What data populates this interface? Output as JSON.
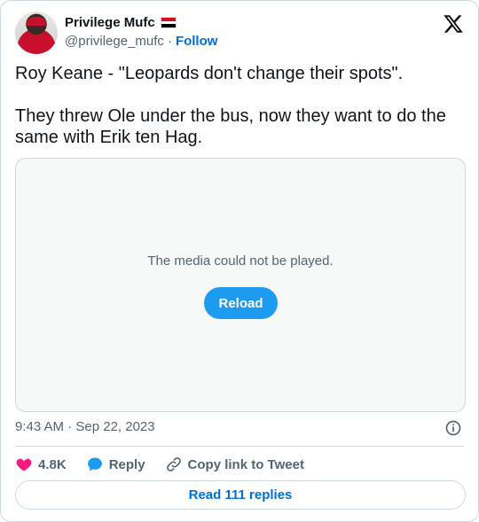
{
  "author": {
    "name": "Privilege Mufc",
    "handle": "@privilege_mufc",
    "separator": "·",
    "follow_label": "Follow",
    "flag_colors": [
      "#ce1126",
      "#ffffff",
      "#000000"
    ]
  },
  "tweet": {
    "text": "Roy Keane - \"Leopards don't change their spots\".\n\nThey threw Ole under the bus, now they want to do the same with Erik ten Hag.",
    "timestamp": "9:43 AM · Sep 22, 2023"
  },
  "media": {
    "message": "The media could not be played.",
    "reload_label": "Reload"
  },
  "actions": {
    "likes": "4.8K",
    "reply_label": "Reply",
    "copy_label": "Copy link to Tweet"
  },
  "footer": {
    "read_replies_label": "Read 111 replies"
  },
  "colors": {
    "accent": "#1d9bf0",
    "link": "#006fd6",
    "like": "#f91880",
    "muted": "#536471"
  },
  "icons": [
    "x-logo-icon",
    "info-icon",
    "heart-icon",
    "reply-bubble-icon",
    "link-icon"
  ]
}
